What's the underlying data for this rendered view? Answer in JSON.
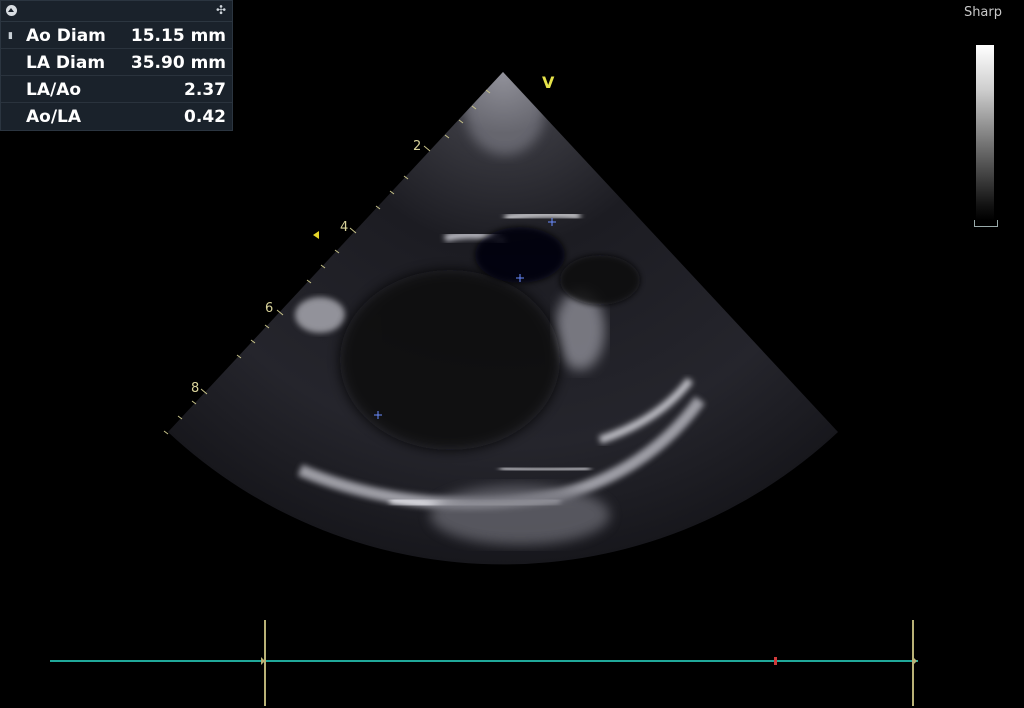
{
  "measurements": {
    "rows": [
      {
        "label": "Ao Diam",
        "value": "15.15 mm"
      },
      {
        "label": "LA Diam",
        "value": "35.90 mm"
      },
      {
        "label": "LA/Ao",
        "value": "2.37"
      },
      {
        "label": "Ao/LA",
        "value": "0.42"
      }
    ],
    "move_icon": "move-icon",
    "collapse_icon": "collapse-icon"
  },
  "image_mode": "Sharp",
  "orientation_marker": "V",
  "depth_labels": [
    "2",
    "4",
    "6",
    "8"
  ],
  "colors": {
    "panel_bg": "#1a222b",
    "timeline": "#20a89a",
    "cursor": "#b9b277",
    "depth_text": "#d8d29a",
    "orientation": "#e6e34a",
    "frame_marker": "#d23a3a"
  }
}
